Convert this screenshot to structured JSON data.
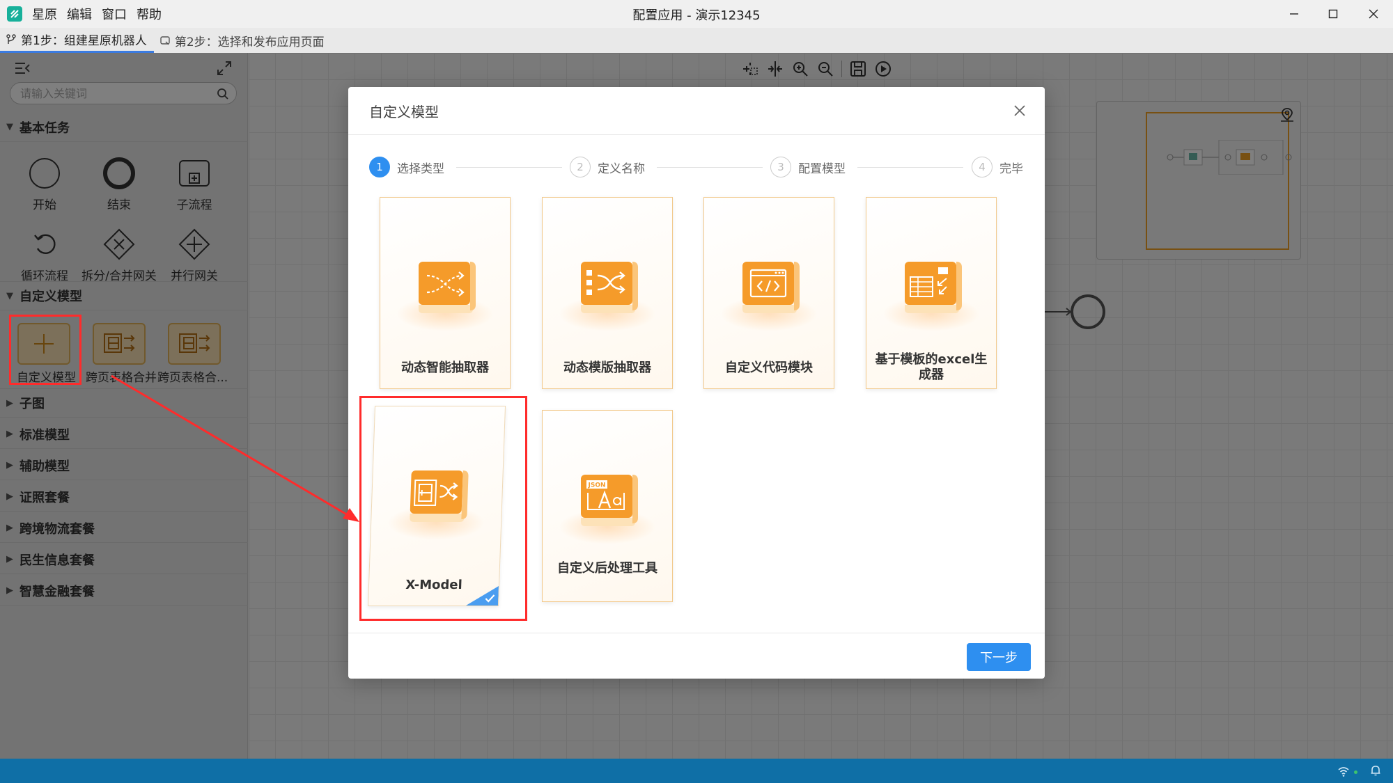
{
  "window": {
    "title": "配置应用 - 演示12345",
    "menu": [
      "星原",
      "编辑",
      "窗口",
      "帮助"
    ]
  },
  "step_tabs": [
    {
      "label": "第1步：组建星原机器人",
      "active": true
    },
    {
      "label": "第2步：选择和发布应用页面",
      "active": false
    }
  ],
  "left_panel": {
    "search_placeholder": "请输入关键词",
    "sections": {
      "basic": "基本任务",
      "custom": "自定义模型",
      "subgraph": "子图",
      "standard": "标准模型",
      "auxiliary": "辅助模型",
      "certificate": "证照套餐",
      "logistics": "跨境物流套餐",
      "livelihood": "民生信息套餐",
      "finance": "智慧金融套餐"
    },
    "basic_tools": [
      "开始",
      "结束",
      "子流程",
      "循环流程",
      "拆分/合并网关",
      "并行网关"
    ],
    "custom_tools": [
      "自定义模型",
      "跨页表格合并",
      "跨页表格合..."
    ]
  },
  "dialog": {
    "title": "自定义模型",
    "steps": [
      {
        "num": "1",
        "label": "选择类型",
        "active": true
      },
      {
        "num": "2",
        "label": "定义名称",
        "active": false
      },
      {
        "num": "3",
        "label": "配置模型",
        "active": false
      },
      {
        "num": "4",
        "label": "完毕",
        "active": false
      }
    ],
    "cards": [
      {
        "title": "动态智能抽取器",
        "icon": "shuffle-icon"
      },
      {
        "title": "动态模版抽取器",
        "icon": "template-shuffle-icon"
      },
      {
        "title": "自定义代码模块",
        "icon": "code-icon"
      },
      {
        "title": "基于模板的excel生成器",
        "icon": "excel-generator-icon"
      },
      {
        "title": "X-Model",
        "icon": "x-model-icon",
        "selected": true
      },
      {
        "title": "自定义后处理工具",
        "icon": "json-text-icon"
      }
    ],
    "json_badge": "JSON",
    "next_label": "下一步"
  },
  "colors": {
    "accent": "#2e8ff0",
    "card_orange": "#f59b2a",
    "annotation_red": "#ff2b2b",
    "statusbar": "#0f6fa6",
    "minimap_frame": "#f0a024"
  }
}
